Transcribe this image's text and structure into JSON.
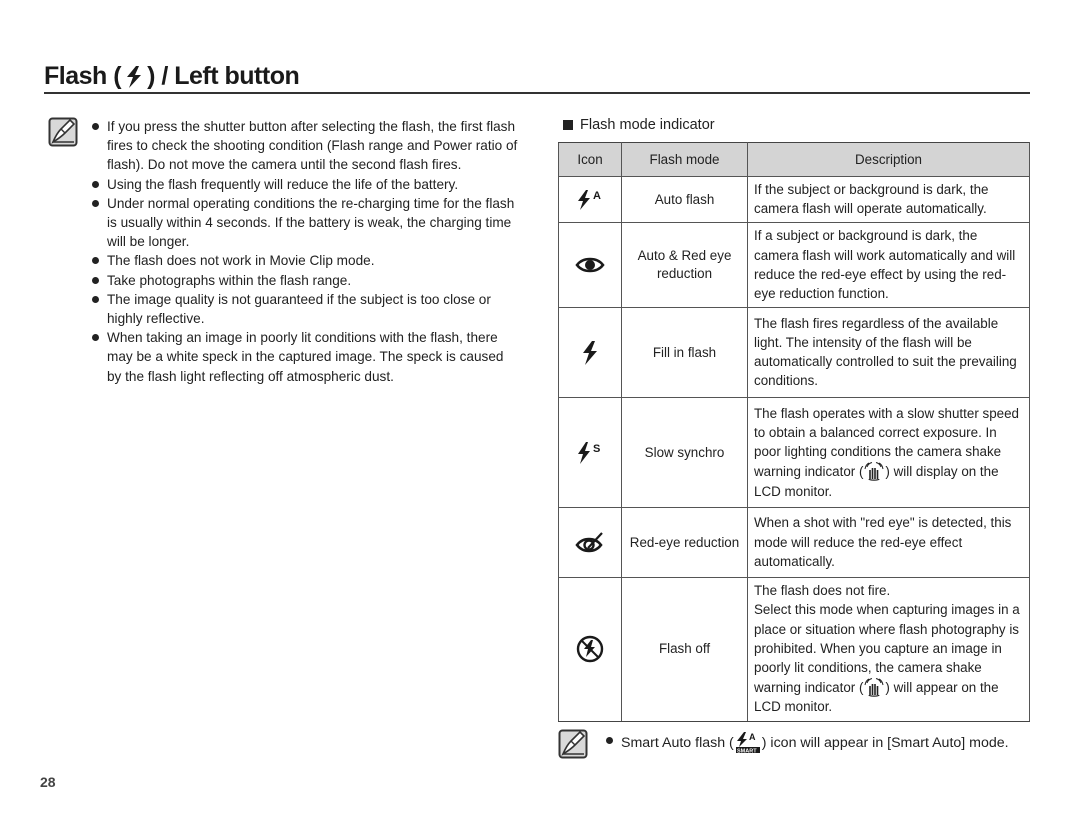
{
  "header": {
    "title_prefix": "Flash (",
    "title_icon": "flash-icon",
    "title_suffix": ") / Left button"
  },
  "left_notes": {
    "icon": "note-pencil-icon",
    "bullets": [
      "If you press the shutter button after selecting the flash, the first flash fires to check the shooting condition (Flash range and Power ratio of flash). Do not move the camera until the second flash fires.",
      "Using the flash frequently will reduce the life of the battery.",
      "Under normal operating conditions the re-charging time for the flash is usually within 4 seconds. If the battery is weak, the charging time will be longer.",
      "The flash does not work in Movie Clip mode.",
      "Take photographs within the flash range.",
      "The image quality is not guaranteed if the subject is too close or highly reflective.",
      "When taking an image in poorly lit conditions with the flash, there may be a white speck in the captured image. The speck is caused by the flash light reflecting off atmospheric dust."
    ]
  },
  "flash_table": {
    "section_title": "Flash mode indicator",
    "headers": [
      "Icon",
      "Flash mode",
      "Description"
    ],
    "rows": [
      {
        "icon": "auto-flash-icon",
        "mode": "Auto flash",
        "desc": "If the subject or background is dark, the camera flash will operate automatically."
      },
      {
        "icon": "red-eye-auto-icon",
        "mode": "Auto & Red eye reduction",
        "desc": "If a subject or background is dark, the camera flash will work automatically and will reduce the red-eye effect by using the red-eye reduction function."
      },
      {
        "icon": "fill-flash-icon",
        "mode": "Fill in flash",
        "desc": "The flash fires regardless of the available light. The intensity of the flash will be automatically controlled to suit the prevailing conditions."
      },
      {
        "icon": "slow-synchro-icon",
        "mode": "Slow synchro",
        "desc_before": "The flash operates with a slow shutter speed to obtain a balanced correct exposure. In poor lighting conditions the camera shake warning indicator (",
        "desc_icon": "camera-shake-icon",
        "desc_after": ") will display on the LCD monitor."
      },
      {
        "icon": "red-eye-fix-icon",
        "mode": "Red-eye reduction",
        "desc": "When a shot with \"red eye\" is detected, this mode will reduce the red-eye effect automatically."
      },
      {
        "icon": "flash-off-icon",
        "mode": "Flash off",
        "desc_line1": "The flash does not fire.",
        "desc_before": "Select this mode when capturing images in a place or situation where flash photography is prohibited. When you capture an image in poorly lit conditions, the camera shake warning indicator (",
        "desc_icon": "camera-shake-icon",
        "desc_after": ") will appear on the LCD monitor."
      }
    ]
  },
  "bottom_note": {
    "icon": "note-pencil-icon",
    "text_before": "Smart Auto flash (",
    "inline_icon": "smart-auto-flash-icon",
    "text_after": ") icon will appear in [Smart Auto] mode."
  },
  "footer": {
    "page_number": "28"
  }
}
